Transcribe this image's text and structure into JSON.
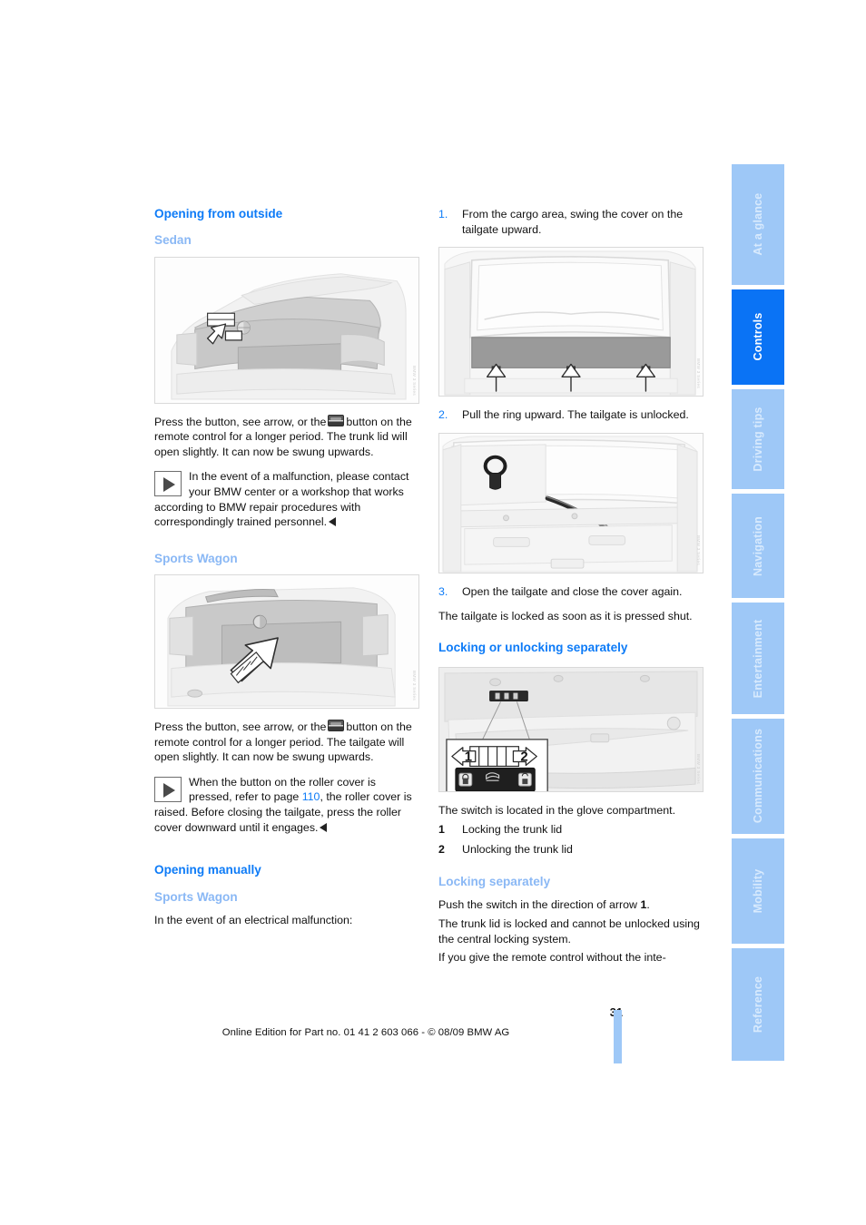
{
  "document": {
    "page_number": "31",
    "edition_line": "Online Edition for Part no. 01 41 2 603 066 - © 08/09 BMW AG"
  },
  "colors": {
    "heading_blue": "#0d7bf7",
    "subheading_blue": "#8ab8f5",
    "tab_inactive": "#9ec8f7",
    "tab_active": "#0a73f5",
    "tab_label": "#ffffff",
    "tab_label_pale": "#d8eafd",
    "body_text": "#111111"
  },
  "tab_rail": {
    "items": [
      {
        "label": "At a glance",
        "active": false,
        "pale": true
      },
      {
        "label": "Controls",
        "active": true,
        "pale": false
      },
      {
        "label": "Driving tips",
        "active": false,
        "pale": true
      },
      {
        "label": "Navigation",
        "active": false,
        "pale": true
      },
      {
        "label": "Entertainment",
        "active": false,
        "pale": true
      },
      {
        "label": "Communications",
        "active": false,
        "pale": true
      },
      {
        "label": "Mobility",
        "active": false,
        "pale": true
      },
      {
        "label": "Reference",
        "active": false,
        "pale": true
      }
    ]
  },
  "left_column": {
    "heading_opening_from_outside": "Opening from outside",
    "sub_sedan": "Sedan",
    "figure_sedan": {
      "caption_alt": "Rear view of BMW sedan trunk lid with arrow pointing to the release button under the trunk handle strip",
      "watermark": "BMW 3 Series"
    },
    "sedan_para_1_a": "Press the button, see arrow, or the",
    "sedan_para_1_b": "button on the remote control for a longer period. The trunk lid will open slightly. It can now be swung upwards.",
    "sedan_note": "In the event of a malfunction, please contact your BMW center or a workshop that works according to BMW repair procedures with correspondingly trained personnel.",
    "sub_sports_wagon_1": "Sports Wagon",
    "figure_wagon": {
      "caption_alt": "Rear view of BMW Sports Wagon tailgate with arrow pointing up at the release button below the BMW roundel",
      "watermark": "BMW 3 Series"
    },
    "wagon_para_1_a": "Press the button, see arrow, or the",
    "wagon_para_1_b": "button on the remote control for a longer period. The tailgate will open slightly. It can now be swung upwards.",
    "wagon_note_a": "When the button on the roller cover is pressed, refer to page",
    "wagon_note_pageref": "110",
    "wagon_note_b": ", the roller cover is raised. Before closing the tailgate, press the roller cover downward until it engages.",
    "heading_opening_manually": "Opening manually",
    "sub_sports_wagon_2": "Sports Wagon",
    "manual_intro": "In the event of an electrical malfunction:"
  },
  "right_column": {
    "step_1": {
      "number": "1.",
      "text": "From the cargo area, swing the cover on the tailgate upward."
    },
    "figure_step1": {
      "caption_alt": "Interior view from cargo area of the tailgate trim cover with three upward arrows indicating swinging the cover up",
      "watermark": "BMW 3 Series"
    },
    "step_2": {
      "number": "2.",
      "text": "Pull the ring upward. The tailgate is unlocked."
    },
    "figure_step2": {
      "caption_alt": "Interior view of the opened tailgate trim showing the emergency release ring and pull cable",
      "watermark": "BMW 3 Series"
    },
    "step_3": {
      "number": "3.",
      "text": "Open the tailgate and close the cover again."
    },
    "after_steps": "The tailgate is locked as soon as it is pressed shut.",
    "heading_locking_or_unlocking": "Locking or unlocking separately",
    "figure_switch": {
      "caption_alt": "Open glove compartment with inset detail of the trunk lock switch, arrow 1 to the left and arrow 2 to the right",
      "watermark": "BMW 3 Series",
      "inset_marker_1": "1",
      "inset_marker_2": "2"
    },
    "switch_location": "The switch is located in the glove compartment.",
    "legend": [
      {
        "key": "1",
        "text": "Locking the trunk lid"
      },
      {
        "key": "2",
        "text": "Unlocking the trunk lid"
      }
    ],
    "heading_locking_separately": "Locking separately",
    "locking_para_a": "Push the switch in the direction of arrow",
    "locking_para_bold": "1",
    "locking_para_b": ".",
    "locking_para_2": "The trunk lid is locked and cannot be unlocked using the central locking system.",
    "locking_para_3": "If you give the remote control without the inte-"
  }
}
